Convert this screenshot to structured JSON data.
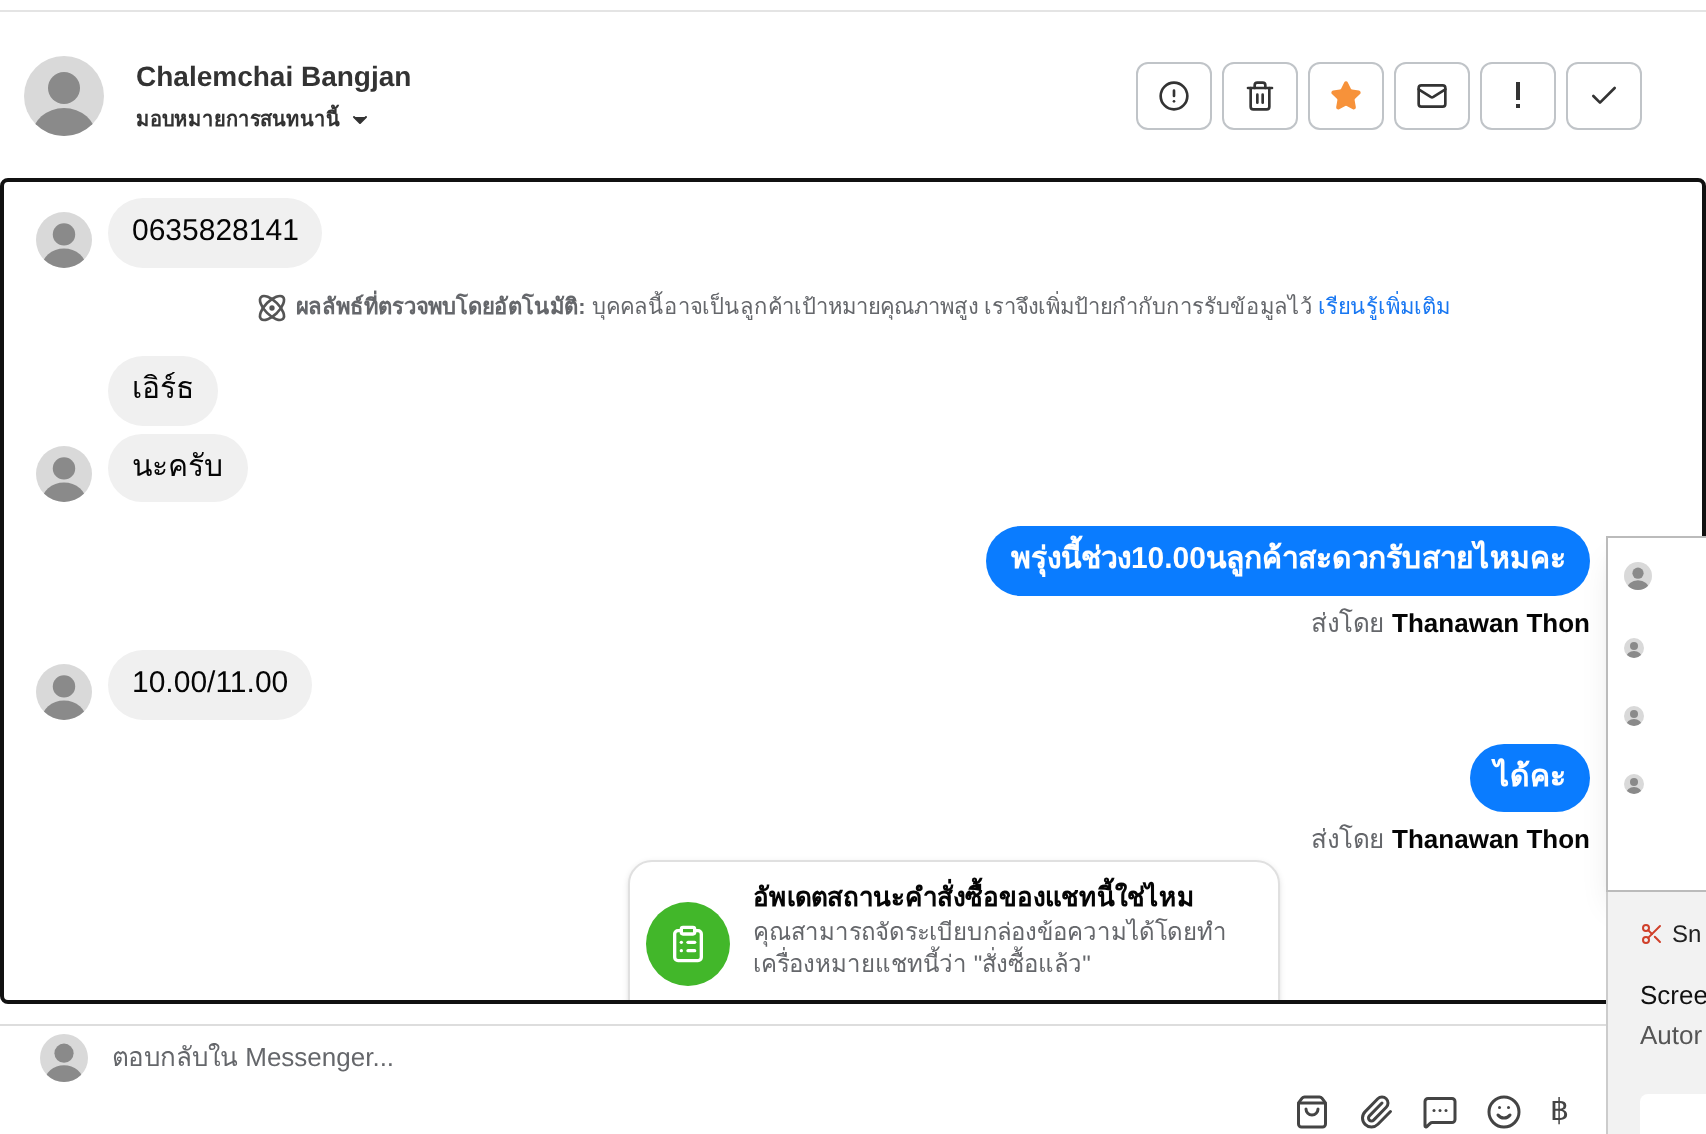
{
  "header": {
    "name": "Chalemchai Bangjan",
    "assign_label": "มอบหมายการสนทนานี้"
  },
  "actions": [
    {
      "kind": "alert",
      "active": false
    },
    {
      "kind": "trash",
      "active": false
    },
    {
      "kind": "star",
      "active": true
    },
    {
      "kind": "mail",
      "active": false
    },
    {
      "kind": "exclaim",
      "active": false
    },
    {
      "kind": "check",
      "active": false
    }
  ],
  "messages": [
    {
      "kind": "incoming",
      "text": "0635828141",
      "avatar": true
    },
    {
      "kind": "notice",
      "label": "ผลลัพธ์ที่ตรวจพบโดยอัตโนมัติ:",
      "text": "บุคคลนี้อาจเป็นลูกค้าเป้าหมายคุณภาพสูง เราจึงเพิ่มป้ายกำกับการรับข้อมูลไว้",
      "link": "เรียนรู้เพิ่มเติม"
    },
    {
      "kind": "incoming",
      "text": "เอิร์ธ",
      "avatar": false
    },
    {
      "kind": "incoming",
      "text": "นะครับ",
      "avatar": true
    },
    {
      "kind": "outgoing",
      "text": "พรุ่งนี้ช่วง10.00นลูกค้าสะดวกรับสายไหมคะ",
      "sent_by": "ส่งโดย",
      "sender": "Thanawan Thon"
    },
    {
      "kind": "incoming",
      "text": "10.00/11.00",
      "avatar": true
    },
    {
      "kind": "outgoing",
      "text": "ได้คะ",
      "sent_by": "ส่งโดย",
      "sender": "Thanawan Thon"
    }
  ],
  "prompt_card": {
    "title": "อัพเดตสถานะคำสั่งซื้อของแชทนี้ใช่ไหม",
    "body": "คุณสามารถจัดระเบียบกล่องข้อความได้โดยทำเครื่องหมายแชทนี้ว่า \"สั่งซื้อแล้ว\""
  },
  "composer": {
    "placeholder": "ตอบกลับใน Messenger...",
    "tools": [
      {
        "kind": "bag"
      },
      {
        "kind": "attach"
      },
      {
        "kind": "saved-replies"
      },
      {
        "kind": "emoji"
      }
    ],
    "payment_symbol": "฿"
  },
  "notification": {
    "app": "Sn",
    "title": "Scree",
    "body": "Autor"
  }
}
